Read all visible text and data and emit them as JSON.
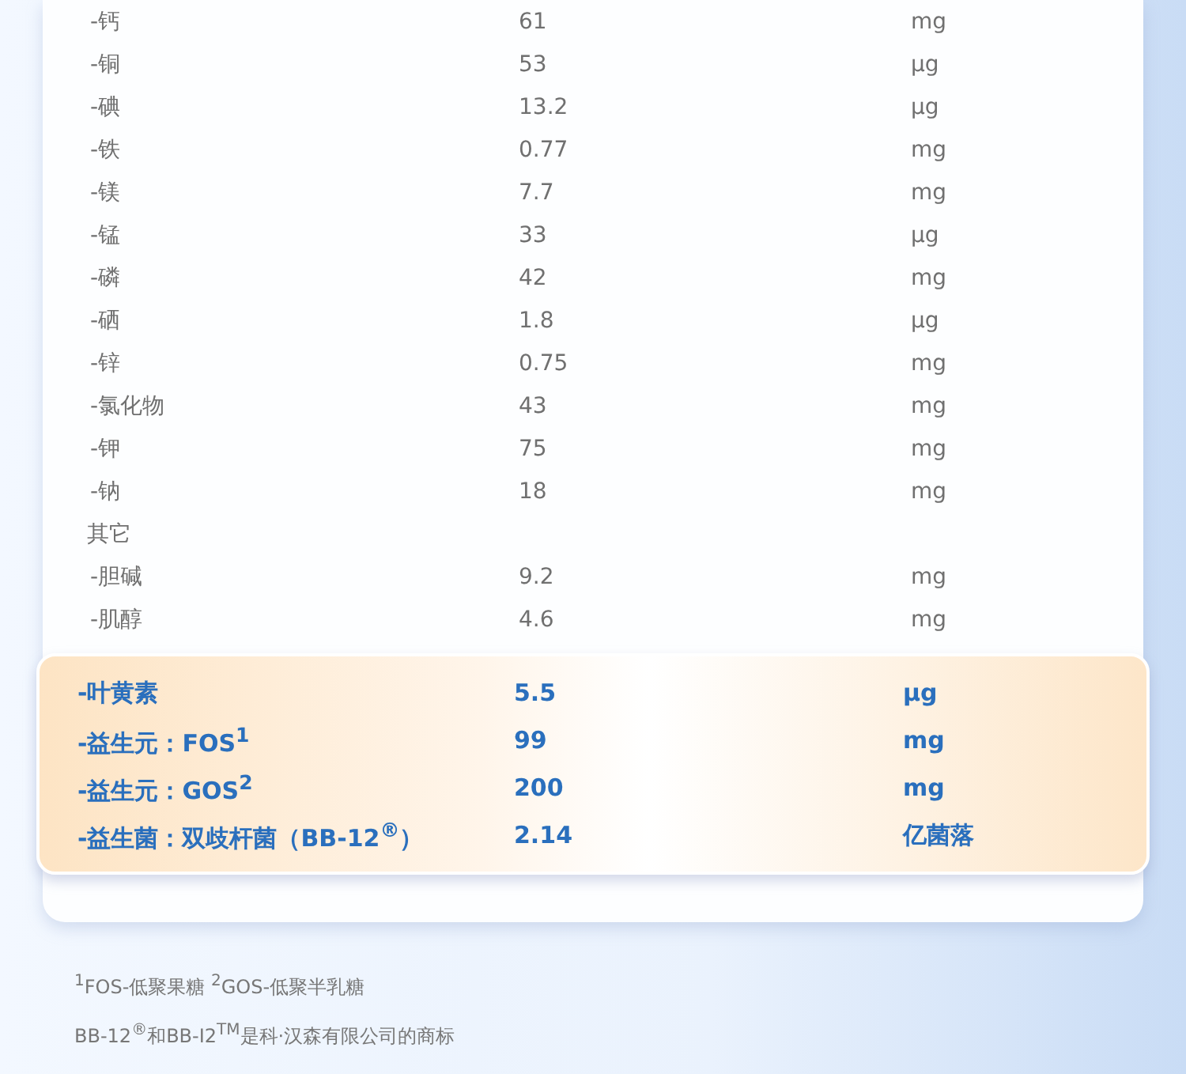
{
  "nutrients": [
    {
      "kind": "item",
      "name": "-钙",
      "value": "61",
      "unit": "mg"
    },
    {
      "kind": "item",
      "name": "-铜",
      "value": "53",
      "unit": "μg"
    },
    {
      "kind": "item",
      "name": "-碘",
      "value": "13.2",
      "unit": "μg"
    },
    {
      "kind": "item",
      "name": "-铁",
      "value": "0.77",
      "unit": "mg"
    },
    {
      "kind": "item",
      "name": "-镁",
      "value": "7.7",
      "unit": "mg"
    },
    {
      "kind": "item",
      "name": "-锰",
      "value": "33",
      "unit": "μg"
    },
    {
      "kind": "item",
      "name": "-磷",
      "value": "42",
      "unit": "mg"
    },
    {
      "kind": "item",
      "name": "-硒",
      "value": "1.8",
      "unit": "μg"
    },
    {
      "kind": "item",
      "name": "-锌",
      "value": "0.75",
      "unit": "mg"
    },
    {
      "kind": "item",
      "name": "-氯化物",
      "value": "43",
      "unit": "mg"
    },
    {
      "kind": "item",
      "name": "-钾",
      "value": "75",
      "unit": "mg"
    },
    {
      "kind": "item",
      "name": "-钠",
      "value": "18",
      "unit": "mg"
    },
    {
      "kind": "section",
      "name": "其它"
    },
    {
      "kind": "item",
      "name": "-胆碱",
      "value": "9.2",
      "unit": "mg"
    },
    {
      "kind": "item",
      "name": "-肌醇",
      "value": "4.6",
      "unit": "mg"
    }
  ],
  "highlights": [
    {
      "name": "-叶黄素",
      "value": "5.5",
      "unit": "μg"
    },
    {
      "name": "-益生元：FOS$^{1}$",
      "value": "99",
      "unit": "mg"
    },
    {
      "name": "-益生元：GOS$^{2}$",
      "value": "200",
      "unit": "mg"
    },
    {
      "name": "-益生菌：双歧杆菌（BB-12$^{®}$）",
      "value": "2.14",
      "unit": "亿菌落"
    }
  ],
  "footnotes": [
    "$^{1}$FOS-低聚果糖 $^{2}$GOS-低聚半乳糖",
    "BB-12$^{®}$和BB-I2$^{TM}$是科·汉森有限公司的商标"
  ]
}
